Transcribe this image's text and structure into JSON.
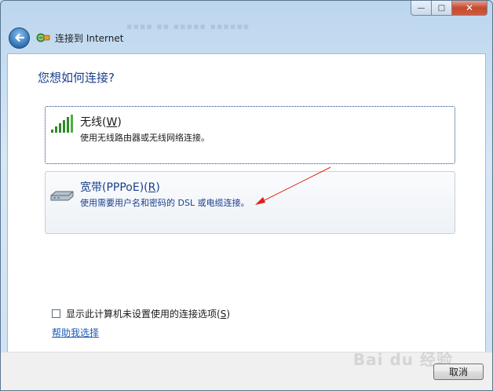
{
  "window": {
    "title": "连接到 Internet",
    "buttons": {
      "minimize": "—",
      "maximize": "□",
      "close": "✕"
    }
  },
  "nav": {
    "back_icon": "back-arrow-icon",
    "app_icon": "network-globe-icon"
  },
  "main": {
    "heading": "您想如何连接?",
    "options": [
      {
        "title": "无线",
        "mnemonic": "W",
        "description": "使用无线路由器或无线网络连接。",
        "icon": "wireless-signal-icon"
      },
      {
        "title": "宽带(PPPoE)",
        "mnemonic": "R",
        "description": "使用需要用户名和密码的 DSL 或电缆连接。",
        "icon": "broadband-modem-icon"
      }
    ],
    "checkbox": {
      "label": "显示此计算机未设置使用的连接选项",
      "mnemonic": "S",
      "checked": false
    },
    "help_link": "帮助我选择"
  },
  "footer": {
    "cancel_label": "取消"
  },
  "watermark": "Bai du 经验",
  "colors": {
    "heading": "#1a3e8c",
    "link": "#1c5bb8",
    "annotation": "#e0201a"
  }
}
